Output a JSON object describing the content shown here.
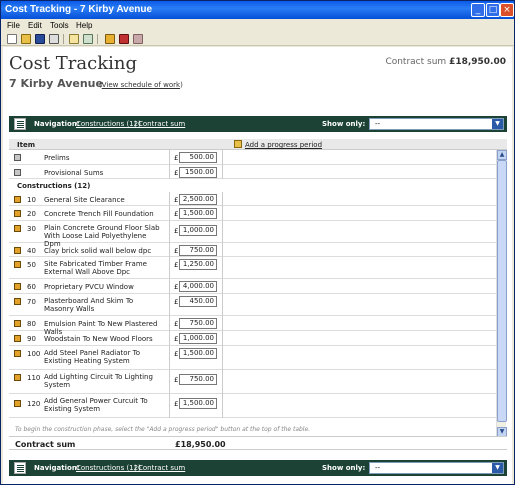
{
  "window": {
    "title": "Cost Tracking - 7 Kirby Avenue"
  },
  "menu": [
    "File",
    "Edit",
    "Tools",
    "Help"
  ],
  "toolbar_icons": [
    "new-file-icon",
    "open-folder-icon",
    "save-icon",
    "print-icon",
    "mail-icon",
    "export-icon",
    "bookmark-icon",
    "grid-icon",
    "table-icon"
  ],
  "page": {
    "title": "Cost Tracking",
    "subtitle": "7 Kirby Avenue",
    "schedule_link": "View schedule of work",
    "contract_sum_label": "Contract sum",
    "contract_sum_value": "£18,950.00"
  },
  "nav": {
    "label": "Navigation:",
    "link_constructions": "Constructions (12)",
    "separator": "|",
    "link_contract_sum": "Contract sum",
    "show_only_label": "Show only:",
    "show_only_value": "--"
  },
  "table": {
    "item_header": "Item",
    "add_progress_label": "Add a progress period",
    "currency": "£",
    "group_constructions": "Constructions (12)",
    "prelim_rows": [
      {
        "code": "",
        "desc": "Prelims",
        "value": "500.00"
      },
      {
        "code": "",
        "desc": "Provisional Sums",
        "value": "1500.00"
      }
    ],
    "construction_rows": [
      {
        "code": "10",
        "desc": "General Site Clearance",
        "value": "2,500.00"
      },
      {
        "code": "20",
        "desc": "Concrete Trench Fill Foundation",
        "value": "1,500.00"
      },
      {
        "code": "30",
        "desc": "Plain Concrete Ground Floor Slab With Loose Laid Polyethylene Dpm",
        "value": "1,000.00"
      },
      {
        "code": "40",
        "desc": "Clay brick solid wall below dpc",
        "value": "750.00"
      },
      {
        "code": "50",
        "desc": "Site Fabricated Timber Frame External Wall Above Dpc",
        "value": "1,250.00"
      },
      {
        "code": "60",
        "desc": "Proprietary PVCU Window",
        "value": "4,000.00"
      },
      {
        "code": "70",
        "desc": "Plasterboard And Skim To Masonry Walls",
        "value": "450.00"
      },
      {
        "code": "80",
        "desc": "Emulsion Paint To New Plastered Walls",
        "value": "750.00"
      },
      {
        "code": "90",
        "desc": "Woodstain To New Wood Floors",
        "value": "1,000.00"
      },
      {
        "code": "100",
        "desc": "Add Steel Panel Radiator To Existing Heating System",
        "value": "1,500.00"
      },
      {
        "code": "110",
        "desc": "Add Lighting Circuit To Lighting System",
        "value": "750.00"
      },
      {
        "code": "120",
        "desc": "Add General Power Curcuit To Existing System",
        "value": "1,500.00"
      }
    ],
    "hint": "To begin the construction phase, select the \"Add a progress period\" button at the top of the table.",
    "total_label": "Contract sum",
    "total_value": "£18,950.00"
  }
}
